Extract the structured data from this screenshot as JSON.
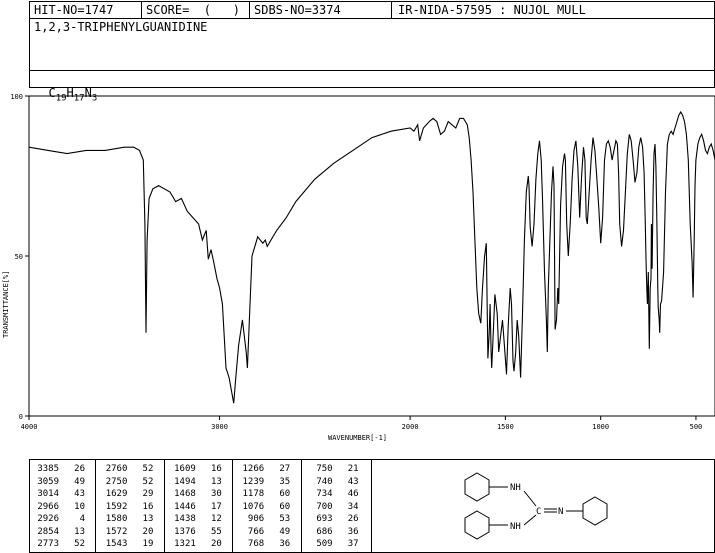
{
  "header": {
    "hit_no": "HIT-NO=1747",
    "score": "SCORE=  (   )",
    "sdbs_no": "SDBS-NO=3374",
    "method": "IR-NIDA-57595 : NUJOL MULL",
    "compound_name": "1,2,3-TRIPHENYLGUANIDINE",
    "formula_parts": [
      "C",
      "19",
      "H",
      "17",
      "N",
      "3"
    ]
  },
  "chart_data": {
    "type": "line",
    "xlabel": "WAVENUMBER[-1]",
    "ylabel": "TRANSMITTANCE[%]",
    "xlim": [
      4000,
      400
    ],
    "ylim": [
      0,
      100
    ],
    "x_ticks": [
      4000,
      3000,
      2000,
      1500,
      1000,
      500
    ],
    "y_ticks": [
      0,
      50,
      100
    ],
    "x_tick_labels": [
      "4000",
      "3000",
      "2000",
      "1500",
      "1000",
      "500"
    ],
    "y_tick_labels": [
      "0",
      "50",
      "100"
    ],
    "series": [
      {
        "x": [
          4000,
          3900,
          3800,
          3700,
          3600,
          3500,
          3450,
          3420,
          3400,
          3392,
          3386,
          3380,
          3370,
          3350,
          3320,
          3290,
          3260,
          3230,
          3200,
          3170,
          3140,
          3110,
          3090,
          3070,
          3059,
          3045,
          3030,
          3014,
          3000,
          2985,
          2966,
          2950,
          2938,
          2926,
          2915,
          2900,
          2880,
          2860,
          2854,
          2845,
          2830,
          2800,
          2773,
          2760,
          2750,
          2740,
          2700,
          2650,
          2600,
          2500,
          2400,
          2300,
          2200,
          2100,
          2000,
          1980,
          1960,
          1950,
          1930,
          1900,
          1880,
          1860,
          1840,
          1820,
          1800,
          1780,
          1760,
          1740,
          1720,
          1700,
          1690,
          1680,
          1670,
          1660,
          1650,
          1640,
          1629,
          1620,
          1609,
          1600,
          1592,
          1585,
          1580,
          1575,
          1572,
          1565,
          1555,
          1543,
          1535,
          1525,
          1515,
          1505,
          1494,
          1485,
          1475,
          1468,
          1460,
          1455,
          1446,
          1438,
          1430,
          1420,
          1410,
          1400,
          1390,
          1380,
          1376,
          1370,
          1360,
          1350,
          1340,
          1330,
          1321,
          1312,
          1305,
          1295,
          1285,
          1280,
          1275,
          1266,
          1258,
          1250,
          1245,
          1239,
          1232,
          1225,
          1220,
          1210,
          1200,
          1190,
          1185,
          1178,
          1170,
          1160,
          1150,
          1140,
          1130,
          1120,
          1110,
          1100,
          1090,
          1083,
          1076,
          1070,
          1060,
          1050,
          1040,
          1030,
          1020,
          1010,
          1000,
          990,
          980,
          970,
          960,
          950,
          940,
          930,
          920,
          912,
          906,
          900,
          890,
          880,
          870,
          860,
          850,
          840,
          830,
          820,
          810,
          800,
          790,
          780,
          772,
          766,
          762,
          758,
          755,
          750,
          745,
          740,
          736,
          734,
          730,
          725,
          720,
          715,
          710,
          705,
          700,
          698,
          693,
          690,
          686,
          680,
          670,
          660,
          650,
          640,
          630,
          620,
          610,
          600,
          590,
          580,
          570,
          560,
          550,
          540,
          530,
          520,
          515,
          509,
          505,
          500,
          490,
          480,
          470,
          460,
          450,
          440,
          430,
          420,
          410,
          400
        ],
        "y": [
          84,
          83,
          82,
          83,
          83,
          84,
          84,
          83,
          80,
          60,
          26,
          55,
          68,
          71,
          72,
          71,
          70,
          67,
          68,
          64,
          62,
          60,
          55,
          58,
          49,
          52,
          48,
          43,
          40,
          35,
          15,
          12,
          8,
          4,
          12,
          22,
          30,
          20,
          15,
          28,
          50,
          56,
          54,
          55,
          53,
          54,
          58,
          62,
          67,
          74,
          79,
          83,
          87,
          89,
          90,
          89,
          91,
          86,
          90,
          92,
          93,
          92,
          88,
          89,
          92,
          91,
          90,
          93,
          93,
          91,
          87,
          80,
          70,
          55,
          40,
          32,
          29,
          40,
          50,
          54,
          18,
          26,
          35,
          20,
          15,
          24,
          38,
          32,
          20,
          25,
          30,
          22,
          13,
          28,
          40,
          35,
          17,
          14,
          20,
          30,
          25,
          12,
          32,
          55,
          70,
          75,
          72,
          59,
          53,
          60,
          74,
          82,
          86,
          80,
          68,
          45,
          30,
          20,
          40,
          56,
          70,
          78,
          72,
          27,
          30,
          40,
          35,
          66,
          78,
          82,
          80,
          60,
          50,
          60,
          74,
          83,
          86,
          78,
          62,
          75,
          84,
          80,
          62,
          60,
          70,
          80,
          87,
          83,
          74,
          65,
          54,
          62,
          80,
          85,
          86,
          84,
          80,
          83,
          86,
          85,
          76,
          60,
          53,
          58,
          70,
          82,
          88,
          86,
          80,
          73,
          76,
          84,
          87,
          84,
          76,
          60,
          49,
          40,
          35,
          45,
          21,
          40,
          43,
          60,
          46,
          70,
          82,
          85,
          78,
          60,
          40,
          34,
          30,
          26,
          35,
          36,
          45,
          70,
          85,
          88,
          89,
          88,
          90,
          92,
          94,
          95,
          94,
          92,
          88,
          80,
          60,
          48,
          37,
          55,
          72,
          80,
          85,
          87,
          88,
          86,
          83,
          82,
          84,
          85,
          83,
          80
        ]
      }
    ]
  },
  "peak_table": {
    "columns": [
      [
        [
          "3385",
          "26"
        ],
        [
          "3059",
          "49"
        ],
        [
          "3014",
          "43"
        ],
        [
          "2966",
          "10"
        ],
        [
          "2926",
          "4"
        ],
        [
          "2854",
          "13"
        ],
        [
          "2773",
          "52"
        ]
      ],
      [
        [
          "2760",
          "52"
        ],
        [
          "2750",
          "52"
        ],
        [
          "1629",
          "29"
        ],
        [
          "1592",
          "16"
        ],
        [
          "1580",
          "13"
        ],
        [
          "1572",
          "20"
        ],
        [
          "1543",
          "19"
        ]
      ],
      [
        [
          "1609",
          "16"
        ],
        [
          "1494",
          "13"
        ],
        [
          "1468",
          "30"
        ],
        [
          "1446",
          "17"
        ],
        [
          "1438",
          "12"
        ],
        [
          "1376",
          "55"
        ],
        [
          "1321",
          "20"
        ]
      ],
      [
        [
          "1266",
          "27"
        ],
        [
          "1239",
          "35"
        ],
        [
          "1178",
          "60"
        ],
        [
          "1076",
          "60"
        ],
        [
          "906",
          "53"
        ],
        [
          "766",
          "49"
        ],
        [
          "768",
          "36"
        ]
      ],
      [
        [
          "750",
          "21"
        ],
        [
          "740",
          "43"
        ],
        [
          "734",
          "46"
        ],
        [
          "700",
          "34"
        ],
        [
          "693",
          "26"
        ],
        [
          "686",
          "36"
        ],
        [
          "509",
          "37"
        ]
      ]
    ]
  },
  "structure": {
    "labels": [
      "NH",
      "C",
      "N",
      "NH"
    ]
  }
}
